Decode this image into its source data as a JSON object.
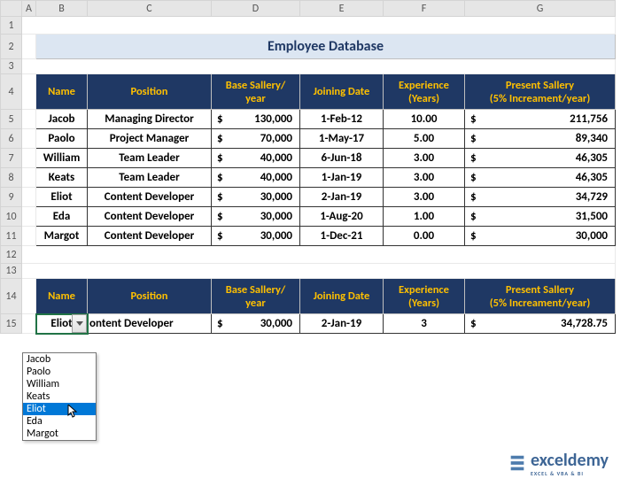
{
  "columns": [
    "",
    "A",
    "B",
    "C",
    "D",
    "E",
    "F",
    "G"
  ],
  "title": "Employee Database",
  "headers": {
    "name": "Name",
    "position": "Position",
    "base": "Base Sallery/\nyear",
    "join": "Joining Date",
    "exp": "Experience\n(Years)",
    "present": "Present Sallery\n(5% Increament/year)"
  },
  "rows": [
    {
      "name": "Jacob",
      "pos": "Managing Director",
      "base": "130,000",
      "join": "1-Feb-12",
      "exp": "10.00",
      "present": "211,756"
    },
    {
      "name": "Paolo",
      "pos": "Project Manager",
      "base": "70,000",
      "join": "1-May-17",
      "exp": "5.00",
      "present": "89,340"
    },
    {
      "name": "William",
      "pos": "Team Leader",
      "base": "40,000",
      "join": "6-Jun-18",
      "exp": "3.00",
      "present": "46,305"
    },
    {
      "name": "Keats",
      "pos": "Team Leader",
      "base": "40,000",
      "join": "1-Jan-19",
      "exp": "3.00",
      "present": "46,305"
    },
    {
      "name": "Eliot",
      "pos": "Content Developer",
      "base": "30,000",
      "join": "2-Jan-19",
      "exp": "3.00",
      "present": "34,729"
    },
    {
      "name": "Eda",
      "pos": "Content Developer",
      "base": "30,000",
      "join": "1-Aug-20",
      "exp": "1.00",
      "present": "31,500"
    },
    {
      "name": "Margot",
      "pos": "Content Developer",
      "base": "30,000",
      "join": "1-Dec-21",
      "exp": "0.00",
      "present": "30,000"
    }
  ],
  "lookup": {
    "name": "Eliot",
    "pos": "ontent Developer",
    "base": "30,000",
    "join": "2-Jan-19",
    "exp": "3",
    "present": "34,728.75"
  },
  "dropdown": {
    "options": [
      "Jacob",
      "Paolo",
      "William",
      "Keats",
      "Eliot",
      "Eda",
      "Margot"
    ],
    "selected": "Eliot"
  },
  "currency": "$",
  "watermark": {
    "main": "exceldemy",
    "sub": "EXCEL & VBA & BI"
  }
}
